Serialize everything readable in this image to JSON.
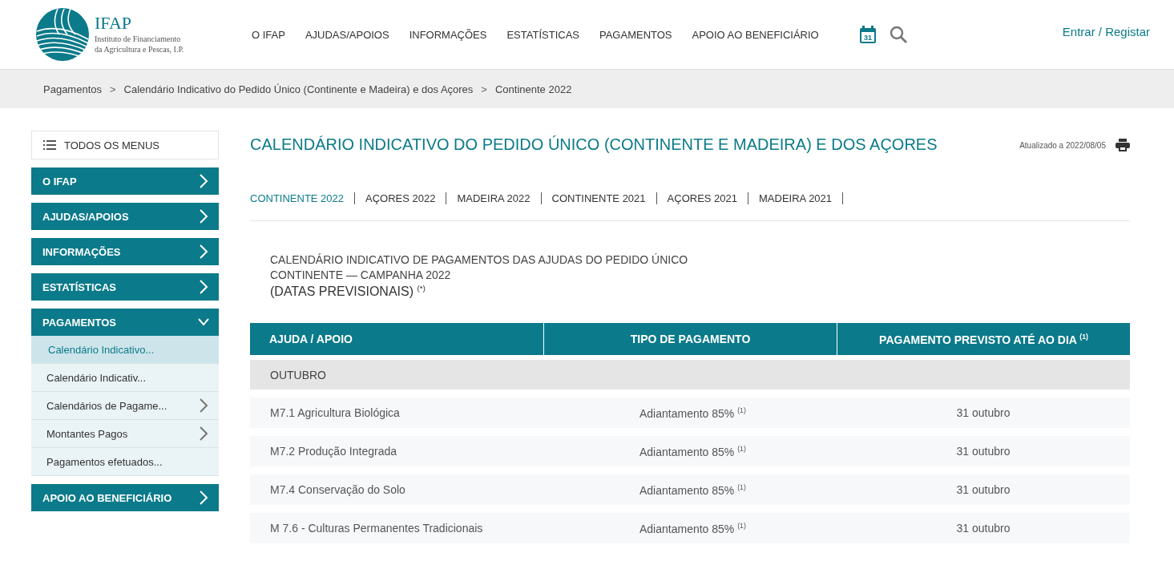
{
  "header": {
    "logo": {
      "name": "IFAP",
      "subtitle_1": "Instituto de Financiamento",
      "subtitle_2": "da Agricultura e Pescas, I.P."
    },
    "nav": [
      "O IFAP",
      "AJUDAS/APOIOS",
      "INFORMAÇÕES",
      "ESTATÍSTICAS",
      "PAGAMENTOS",
      "APOIO AO BENEFICIÁRIO"
    ],
    "calendar_day": "31",
    "login": "Entrar / Registar"
  },
  "breadcrumb": [
    "Pagamentos",
    "Calendário Indicativo do Pedido Único (Continente e Madeira) e dos Açores",
    "Continente 2022"
  ],
  "breadcrumb_separator": ">",
  "sidebar": {
    "all_menus": "TODOS OS MENUS",
    "sections": [
      {
        "label": "O IFAP",
        "expanded": false
      },
      {
        "label": "AJUDAS/APOIOS",
        "expanded": false
      },
      {
        "label": "INFORMAÇÕES",
        "expanded": false
      },
      {
        "label": "ESTATÍSTICAS",
        "expanded": false
      },
      {
        "label": "PAGAMENTOS",
        "expanded": true,
        "children": [
          {
            "label": "Calendário Indicativo...",
            "selected": true,
            "has_children": false
          },
          {
            "label": "Calendário Indicativ...",
            "selected": false,
            "has_children": false
          },
          {
            "label": "Calendários de Pagame...",
            "selected": false,
            "has_children": true
          },
          {
            "label": "Montantes Pagos",
            "selected": false,
            "has_children": true
          },
          {
            "label": "Pagamentos efetuados...",
            "selected": false,
            "has_children": false
          }
        ]
      },
      {
        "label": "APOIO AO BENEFICIÁRIO",
        "expanded": false
      }
    ]
  },
  "page": {
    "title": "CALENDÁRIO INDICATIVO DO PEDIDO ÚNICO (CONTINENTE E MADEIRA) E DOS AÇORES",
    "updated": "Atualizado a 2022/08/05",
    "tabs": [
      {
        "label": "CONTINENTE 2022",
        "selected": true
      },
      {
        "label": "AÇORES 2022",
        "selected": false
      },
      {
        "label": "MADEIRA 2022",
        "selected": false
      },
      {
        "label": "CONTINENTE 2021",
        "selected": false
      },
      {
        "label": "AÇORES 2021",
        "selected": false
      },
      {
        "label": "MADEIRA 2021",
        "selected": false
      }
    ],
    "heading_1": "CALENDÁRIO INDICATIVO DE PAGAMENTOS DAS AJUDAS DO PEDIDO ÚNICO",
    "heading_2": "CONTINENTE — CAMPANHA 2022",
    "heading_note": "(DATAS PREVISIONAIS) $^{(*)}$",
    "table": {
      "columns": [
        "AJUDA / APOIO",
        "TIPO DE PAGAMENTO",
        "PAGAMENTO PREVISTO ATÉ AO DIA $^{(1)}$"
      ],
      "rows": [
        {
          "kind": "group",
          "label": "OUTUBRO"
        },
        {
          "kind": "item",
          "cells": [
            "M7.1 Agricultura Biológica",
            "Adiantamento 85% $^{(1)}$",
            "31 outubro"
          ]
        },
        {
          "kind": "item",
          "cells": [
            "M7.2 Produção Integrada",
            "Adiantamento 85% $^{(1)}$",
            "31 outubro"
          ]
        },
        {
          "kind": "item",
          "cells": [
            "M7.4 Conservação do Solo",
            "Adiantamento 85% $^{(1)}$",
            "31 outubro"
          ]
        },
        {
          "kind": "item",
          "cells": [
            "M 7.6 - Culturas Permanentes Tradicionais",
            "Adiantamento 85% $^{(1)}$",
            "31 outubro"
          ]
        }
      ]
    }
  }
}
